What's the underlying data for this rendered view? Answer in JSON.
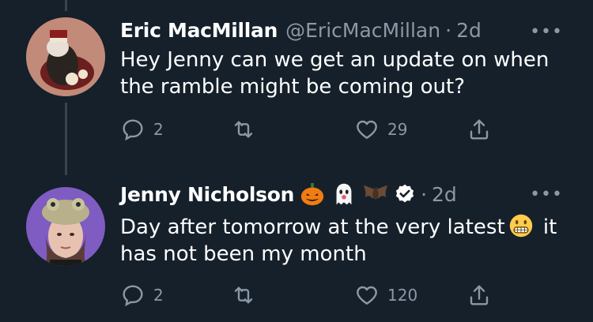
{
  "tweets": [
    {
      "author_name": "Eric MacMillan",
      "handle": "@EricMacMillan",
      "separator": "·",
      "time": "2d",
      "text": "Hey Jenny can we get an update on when the ramble might be coming out?",
      "reply_count": "2",
      "retweet_count": "",
      "like_count": "29",
      "icons": [
        "reply-icon",
        "retweet-icon",
        "like-icon",
        "share-icon",
        "more-icon"
      ]
    },
    {
      "author_name": "Jenny Nicholson",
      "name_emojis": [
        "jack-o-lantern-emoji",
        "ghost-emoji",
        "bat-emoji"
      ],
      "verified": true,
      "separator": "·",
      "time": "2d",
      "text_before_emoji": "Day after tomorrow at the very latest",
      "inline_emoji": "grimacing-face-emoji",
      "text_after_emoji": " it has not been my month",
      "reply_count": "2",
      "retweet_count": "",
      "like_count": "120",
      "icons": [
        "reply-icon",
        "retweet-icon",
        "like-icon",
        "share-icon",
        "more-icon"
      ]
    }
  ],
  "more_label": "•••",
  "colors": {
    "background": "#15202b",
    "primary_text": "#ffffff",
    "secondary_text": "#8b98a5",
    "thread_line": "#38444d"
  }
}
